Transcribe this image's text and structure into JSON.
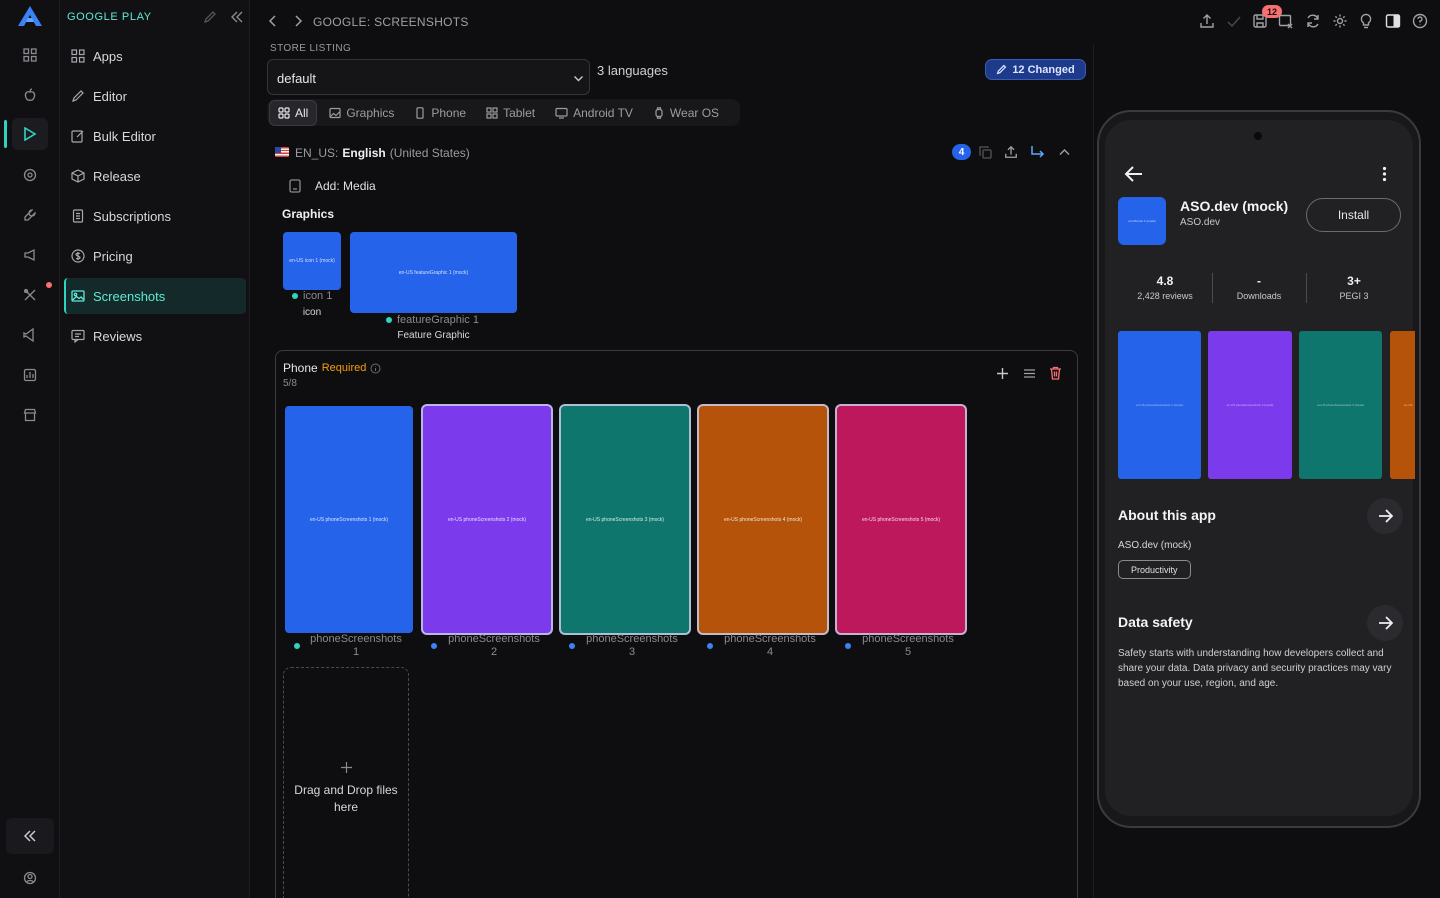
{
  "app": {
    "store": "GOOGLE PLAY"
  },
  "topbar": {
    "breadcrumb": "GOOGLE: SCREENSHOTS",
    "notification_count": "12"
  },
  "nav": {
    "items": [
      {
        "label": "Apps"
      },
      {
        "label": "Editor"
      },
      {
        "label": "Bulk Editor"
      },
      {
        "label": "Release"
      },
      {
        "label": "Subscriptions"
      },
      {
        "label": "Pricing"
      },
      {
        "label": "Screenshots"
      },
      {
        "label": "Reviews"
      }
    ],
    "active": "Screenshots"
  },
  "listing": {
    "section_label": "STORE LISTING",
    "select_value": "default",
    "languages": "3 languages",
    "changed_badge": "12 Changed",
    "filters": [
      "All",
      "Graphics",
      "Phone",
      "Tablet",
      "Android TV",
      "Wear OS"
    ],
    "active_filter": "All"
  },
  "locale": {
    "code": "EN_US:",
    "language": "English",
    "region": "(United States)",
    "count": "4",
    "add_media": "Add: Media"
  },
  "graphics": {
    "heading": "Graphics",
    "icon_text": "en-US icon 1 (mock)",
    "icon_file": "icon 1",
    "icon_type": "icon",
    "feature_text": "en-US featureGraphic 1 (mock)",
    "feature_file": "featureGraphic 1",
    "feature_type": "Feature Graphic"
  },
  "phone_section": {
    "title": "Phone",
    "required": "Required",
    "count": "5/8",
    "screenshots": [
      {
        "text": "en-US phoneScreenshots 1 (mock)",
        "label": "phoneScreenshots",
        "index": "1",
        "color": "#2563eb"
      },
      {
        "text": "en-US phoneScreenshots 2 (mock)",
        "label": "phoneScreenshots",
        "index": "2",
        "color": "#7c3aed"
      },
      {
        "text": "en-US phoneScreenshots 3 (mock)",
        "label": "phoneScreenshots",
        "index": "3",
        "color": "#0f766e"
      },
      {
        "text": "en-US phoneScreenshots 4 (mock)",
        "label": "phoneScreenshots",
        "index": "4",
        "color": "#b45309"
      },
      {
        "text": "en-US phoneScreenshots 5 (mock)",
        "label": "phoneScreenshots",
        "index": "5",
        "color": "#be185d"
      }
    ],
    "dropzone": "Drag and Drop files here"
  },
  "preview": {
    "app_name": "ASO.dev (mock)",
    "developer": "ASO.dev",
    "install": "Install",
    "icon_text": "en-US icon 1 (mock)",
    "rating": "4.8",
    "reviews": "2,428 reviews",
    "downloads_value": "-",
    "downloads_label": "Downloads",
    "pegi_value": "3+",
    "pegi_label": "PEGI 3",
    "shot_texts": [
      "en-US phoneScreenshots 1 (mock)",
      "en-US phoneScreenshots 2 (mock)",
      "en-US phoneScreenshots 3 (mock)",
      "en-US"
    ],
    "about_title": "About this app",
    "about_text": "ASO.dev (mock)",
    "category": "Productivity",
    "safety_title": "Data safety",
    "safety_text": "Safety starts with understanding how developers collect and share your data. Data privacy and security practices may vary based on your use, region, and age."
  },
  "colors": {
    "accent": "#2dd4bf",
    "badge": "#1e3a8a",
    "required": "#f59e0b"
  }
}
